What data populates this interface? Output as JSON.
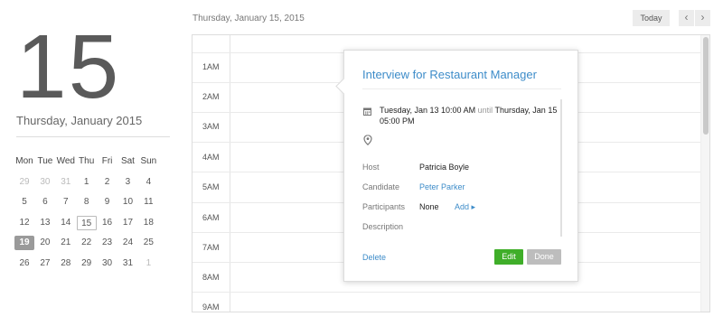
{
  "header": {
    "date_label": "Thursday, January 15, 2015",
    "today_label": "Today",
    "prev_glyph": "‹",
    "next_glyph": "›"
  },
  "left_panel": {
    "big_day": "15",
    "date_subtitle": "Thursday, January 2015",
    "mini_calendar": {
      "weekdays": [
        "Mon",
        "Tue",
        "Wed",
        "Thu",
        "Fri",
        "Sat",
        "Sun"
      ],
      "weeks": [
        [
          "29",
          "30",
          "31",
          "1",
          "2",
          "3",
          "4"
        ],
        [
          "5",
          "6",
          "7",
          "8",
          "9",
          "10",
          "11"
        ],
        [
          "12",
          "13",
          "14",
          "15",
          "16",
          "17",
          "18"
        ],
        [
          "19",
          "20",
          "21",
          "22",
          "23",
          "24",
          "25"
        ],
        [
          "26",
          "27",
          "28",
          "29",
          "30",
          "31",
          "1"
        ]
      ]
    }
  },
  "day_view": {
    "hours": [
      "1AM",
      "2AM",
      "3AM",
      "4AM",
      "5AM",
      "6AM",
      "7AM",
      "8AM",
      "9AM"
    ]
  },
  "popup": {
    "title": "Interview for Restaurant Manager",
    "start": "Tuesday, Jan 13 10:00 AM",
    "until": "until",
    "end": "Thursday, Jan 15 05:00 PM",
    "host_label": "Host",
    "host_value": "Patricia Boyle",
    "candidate_label": "Candidate",
    "candidate_value": "Peter Parker",
    "participants_label": "Participants",
    "participants_value": "None",
    "add_label": "Add ▸",
    "description_label": "Description",
    "delete_label": "Delete",
    "edit_label": "Edit",
    "done_label": "Done"
  },
  "icons": {
    "calendar": "calendar-icon",
    "location": "map-pin-icon"
  },
  "colors": {
    "accent": "#3d8cc9",
    "edit_green": "#3fae29",
    "done_gray": "#bdbdbd",
    "selected_day": "#9a9a9a"
  }
}
